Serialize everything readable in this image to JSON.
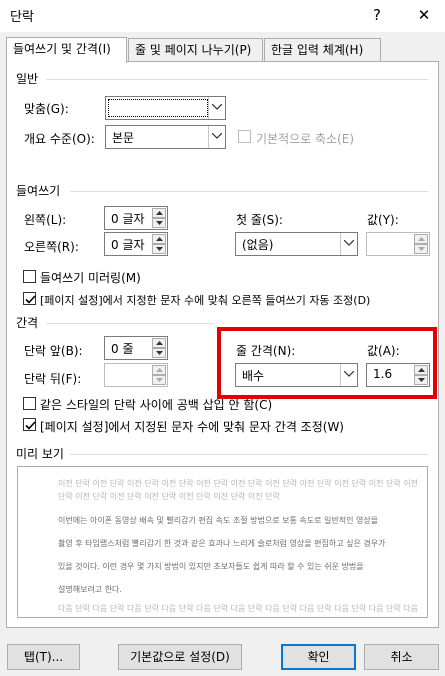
{
  "window": {
    "title": "단락",
    "help_label": "?",
    "close_label": "✕"
  },
  "tabs": [
    {
      "label": "들여쓰기 및 간격(I)"
    },
    {
      "label": "줄 및 페이지 나누기(P)"
    },
    {
      "label": "한글 입력 체계(H)"
    }
  ],
  "general": {
    "heading": "일반",
    "alignment_label": "맞춤(G):",
    "alignment_value": "",
    "outline_label": "개요 수준(O):",
    "outline_value": "본문",
    "collapsed_label": "기본적으로 축소(E)"
  },
  "indent": {
    "heading": "들여쓰기",
    "left_label": "왼쪽(L):",
    "left_value": "0 글자",
    "right_label": "오른쪽(R):",
    "right_value": "0 글자",
    "special_label": "첫 줄(S):",
    "special_value": "(없음)",
    "by_label": "값(Y):",
    "by_value": "",
    "mirror_label": "들여쓰기 미러링(M)",
    "mirror_checked": false,
    "auto_adjust_label": "[페이지 설정]에서 지정한 문자 수에 맞춰 오른쪽 들여쓰기 자동 조정(D)",
    "auto_adjust_checked": true
  },
  "spacing": {
    "heading": "간격",
    "before_label": "단락 앞(B):",
    "before_value": "0 줄",
    "after_label": "단락 뒤(F):",
    "after_value": "",
    "line_spacing_label": "줄 간격(N):",
    "line_spacing_value": "배수",
    "at_label": "값(A):",
    "at_value": "1.6",
    "no_space_label": "같은 스타일의 단락 사이에 공백 삽입 안 함(C)",
    "no_space_checked": false,
    "grid_label": "[페이지 설정]에서 지정된 문자 수에 맞춰 문자 간격 조정(W)",
    "grid_checked": true
  },
  "preview": {
    "heading": "미리 보기",
    "prev_lines": [
      "이전 단락 이전 단락 이전 단락 이전 단락 이전 단락 이전 단락 이전 단락 이전 단락 이전 단락 이전 단락 이전",
      "단락 이전 단락 이전 단락 이전 단락 이전 단락 이전 단락 이전 단락"
    ],
    "sample_lines": [
      "이번에는 아이폰 동영상 배속 및 빨리감기 편집 속도 조절 방법으로 보통 속도로 일반적인 영상을",
      "촬영 후 타임랩스처럼 빨리감기 한 것과 같은 효과나 느리게 슬로처럼 영상을 편집하고 싶은 경우가",
      "있을 것이다. 이런 경우 몇 가지 방법이 있지만 초보자들도 쉽게 따라 할 수 있는 쉬운 방법을",
      "설명해보려고 한다."
    ],
    "next_lines": [
      "다음 단락 다음 단락 다음 단락 다음 단락 다음 단락 다음 단락 다음 단락 다음 단락 다음 단락 다음 단락 다음"
    ]
  },
  "buttons": {
    "tabs_label": "탭(T)...",
    "default_label": "기본값으로 설정(D)",
    "ok_label": "확인",
    "cancel_label": "취소"
  },
  "colors": {
    "highlight_box": "#e30000",
    "default_button_border": "#0078d7"
  }
}
